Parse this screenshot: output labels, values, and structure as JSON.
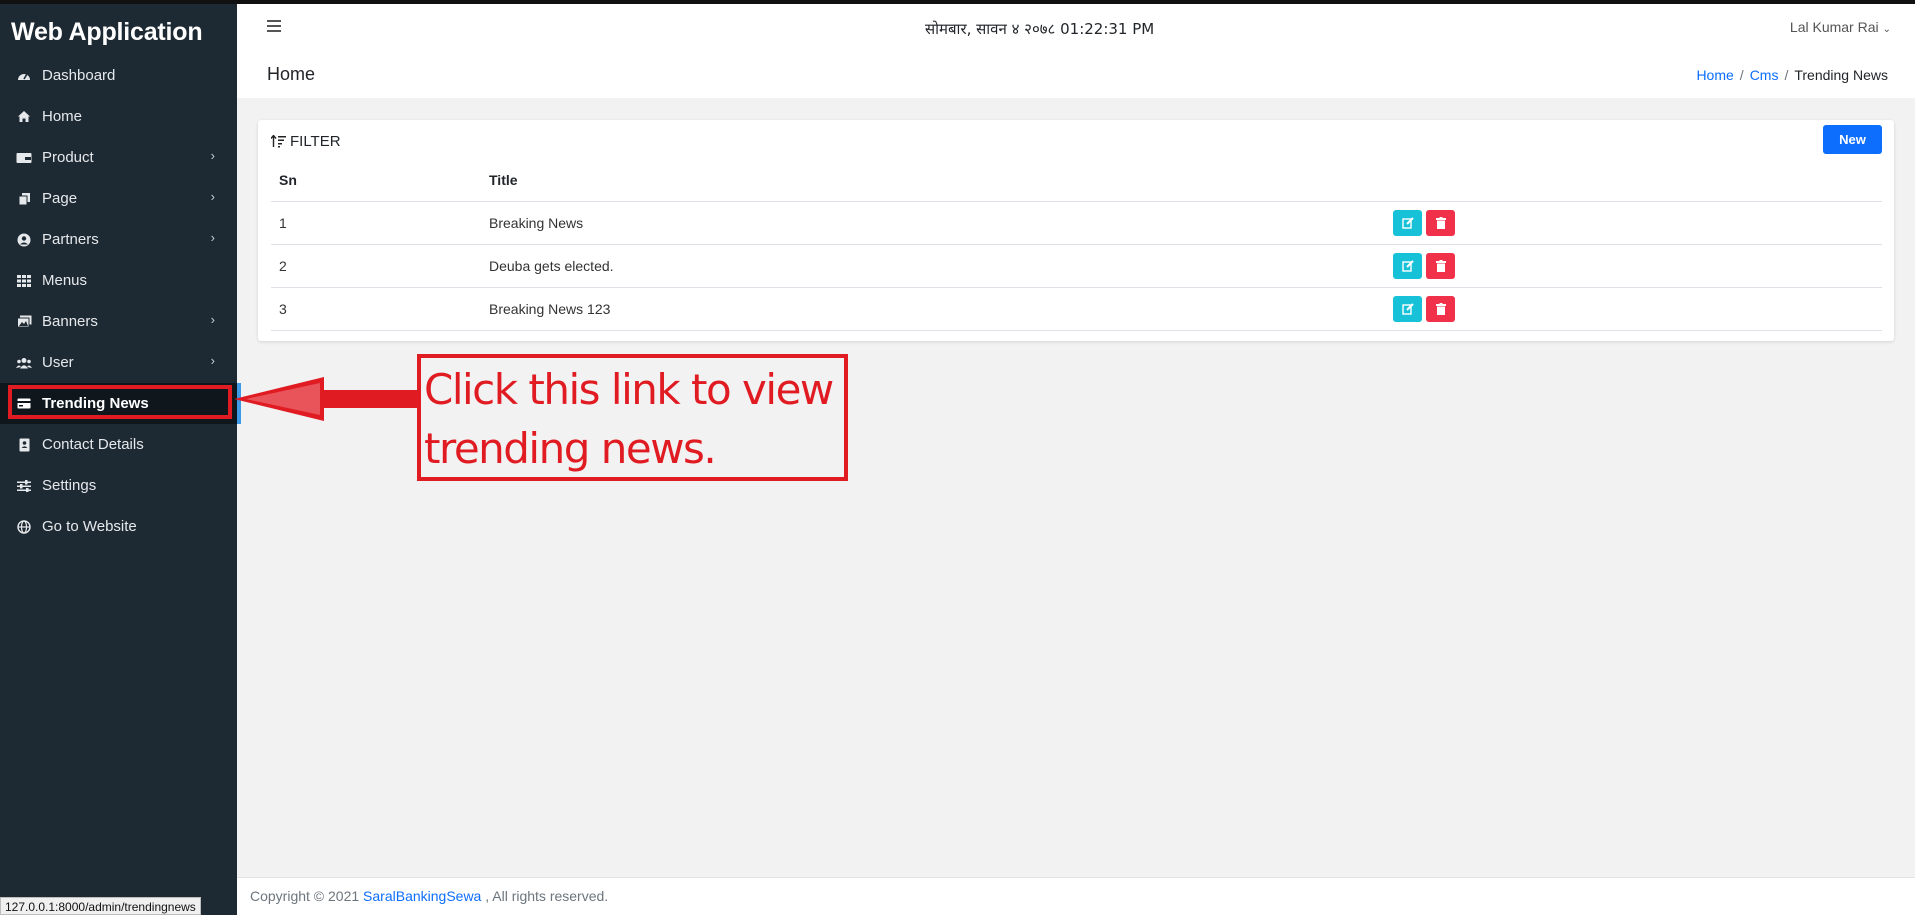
{
  "app": {
    "brand": "Web Application"
  },
  "sidebar": {
    "items": [
      {
        "label": "Dashboard",
        "icon": "dashboard-icon",
        "has_submenu": false
      },
      {
        "label": "Home",
        "icon": "home-icon",
        "has_submenu": false
      },
      {
        "label": "Product",
        "icon": "wallet-icon",
        "has_submenu": true
      },
      {
        "label": "Page",
        "icon": "copy-icon",
        "has_submenu": true
      },
      {
        "label": "Partners",
        "icon": "user-circle-icon",
        "has_submenu": true
      },
      {
        "label": "Menus",
        "icon": "grid-icon",
        "has_submenu": false
      },
      {
        "label": "Banners",
        "icon": "images-icon",
        "has_submenu": true
      },
      {
        "label": "User",
        "icon": "users-icon",
        "has_submenu": true
      },
      {
        "label": "Trending News",
        "icon": "card-icon",
        "has_submenu": false,
        "active": true
      },
      {
        "label": "Contact Details",
        "icon": "contact-icon",
        "has_submenu": false
      },
      {
        "label": "Settings",
        "icon": "sliders-icon",
        "has_submenu": false
      },
      {
        "label": "Go to Website",
        "icon": "globe-icon",
        "has_submenu": false
      }
    ]
  },
  "header": {
    "datetime": "सोमबार, सावन ४ २०७८ 01:22:31 PM",
    "user": "Lal Kumar Rai"
  },
  "titlebar": {
    "title": "Home",
    "breadcrumb": [
      "Home",
      "Cms",
      "Trending News"
    ]
  },
  "card": {
    "filter_label": "FILTER",
    "new_button": "New",
    "columns": [
      "Sn",
      "Title"
    ],
    "rows": [
      {
        "sn": "1",
        "title": "Breaking News"
      },
      {
        "sn": "2",
        "title": "Deuba gets elected."
      },
      {
        "sn": "3",
        "title": "Breaking News 123"
      }
    ]
  },
  "annotation": {
    "line1": "Click this link to view",
    "line2": "trending news."
  },
  "footer": {
    "prefix": "Copyright © 2021 ",
    "link": "SaralBankingSewa",
    "suffix": " , All rights reserved."
  },
  "status_url": "127.0.0.1:8000/admin/trendingnews",
  "colors": {
    "sidebar_bg": "#1e2a33",
    "primary": "#0d6efd",
    "edit": "#17c2d8",
    "delete": "#f1304a",
    "annotation": "#e01b22"
  }
}
